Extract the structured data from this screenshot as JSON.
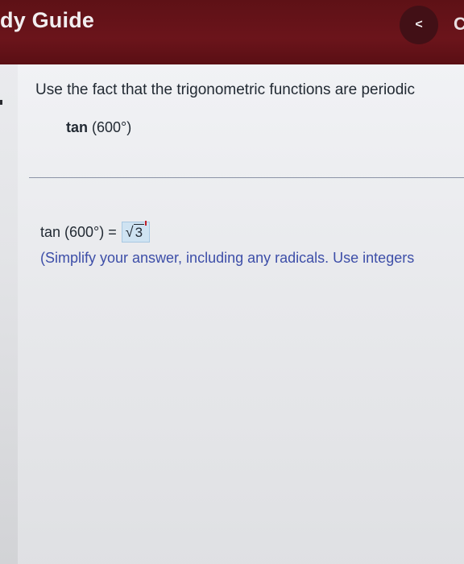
{
  "header": {
    "title": "dy Guide",
    "back_icon": "<",
    "next_peek": "C"
  },
  "question": {
    "prompt": "Use the fact that the trigonometric functions are periodic",
    "expression_fn": "tan",
    "expression_arg": " (600°)"
  },
  "answer": {
    "lhs": "tan (600°) = ",
    "radicand": "3",
    "radical_symbol": "√",
    "hint": "(Simplify your answer, including any radicals. Use integers"
  },
  "colors": {
    "header_bg": "#6b141b",
    "answer_box_bg": "#cfe3f2",
    "hint_text": "#3d4ea8"
  }
}
